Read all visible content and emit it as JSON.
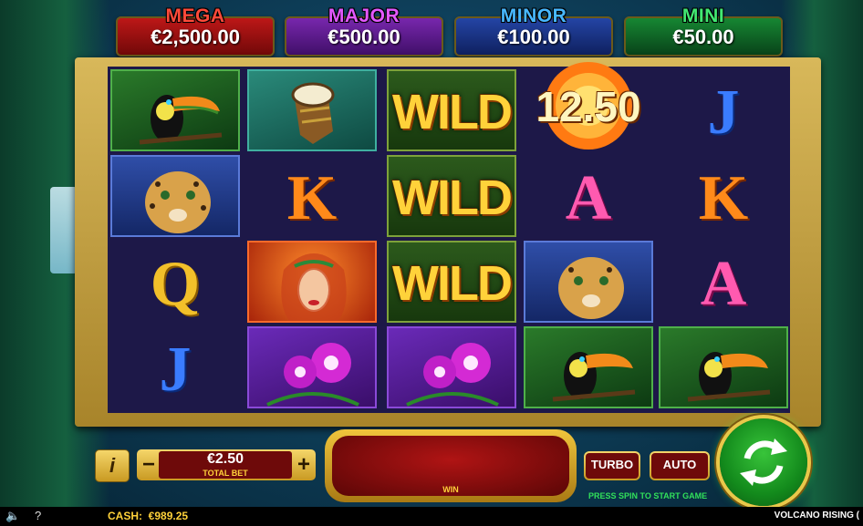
{
  "jackpots": [
    {
      "label": "MEGA",
      "value": "€2,500.00",
      "label_color": "#ff3b3b",
      "bg": "#9a1010"
    },
    {
      "label": "MAJOR",
      "value": "€500.00",
      "label_color": "#e052ff",
      "bg": "#5b1a8a"
    },
    {
      "label": "MINOR",
      "value": "€100.00",
      "label_color": "#3fb4ff",
      "bg": "#16337c"
    },
    {
      "label": "MINI",
      "value": "€50.00",
      "label_color": "#38e06a",
      "bg": "#0e5a24"
    }
  ],
  "reels": [
    [
      "toucan",
      "jaguar",
      "Q",
      "J"
    ],
    [
      "drum",
      "K",
      "woman",
      "orchid"
    ],
    [
      "WILD",
      "WILD",
      "WILD",
      "orchid"
    ],
    [
      "fireball",
      "A",
      "jaguar",
      "toucan"
    ],
    [
      "J",
      "K",
      "A",
      "toucan"
    ]
  ],
  "fireball_value": "12.50",
  "wild_label": "WILD",
  "controls": {
    "info": "i",
    "minus": "−",
    "plus": "+",
    "bet_value": "€2.50",
    "bet_label": "TOTAL BET",
    "win_label": "WIN",
    "turbo": "TURBO",
    "auto": "AUTO",
    "hint": "PRESS SPIN TO START GAME"
  },
  "status": {
    "cash": "CASH:  €989.25",
    "game_name": "VOLCANO RISING (",
    "sound_icon": "speaker-icon",
    "help": "?"
  }
}
